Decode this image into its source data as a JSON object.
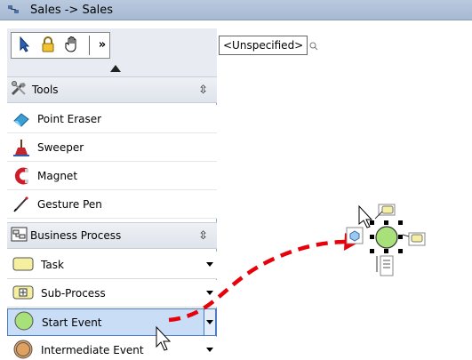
{
  "window": {
    "title": "Sales -> Sales",
    "app_icon": "diagram-app-icon"
  },
  "toolbar": {
    "tools": [
      "pointer-icon",
      "lock-icon",
      "hand-icon"
    ],
    "more_label": "»",
    "collapse_icon": "triangle-up-icon"
  },
  "palette": {
    "tools_section": {
      "title": "Tools",
      "items": [
        {
          "label": "Point Eraser",
          "icon": "eraser-icon"
        },
        {
          "label": "Sweeper",
          "icon": "sweeper-icon"
        },
        {
          "label": "Magnet",
          "icon": "magnet-icon"
        },
        {
          "label": "Gesture Pen",
          "icon": "pen-icon"
        }
      ]
    },
    "bp_section": {
      "title": "Business Process",
      "items": [
        {
          "label": "Task",
          "icon": "task-icon"
        },
        {
          "label": "Sub-Process",
          "icon": "subprocess-icon"
        },
        {
          "label": "Start Event",
          "icon": "start-event-icon",
          "selected": true
        },
        {
          "label": "Intermediate Event",
          "icon": "intermediate-event-icon"
        }
      ]
    }
  },
  "canvas": {
    "tab_label": "<Unspecified>",
    "search_icon": "search-icon"
  },
  "colors": {
    "start_event_fill": "#a8e07a",
    "task_fill": "#f5f0a0",
    "arrow": "#e8000a",
    "selection": "#c9ddf6"
  }
}
